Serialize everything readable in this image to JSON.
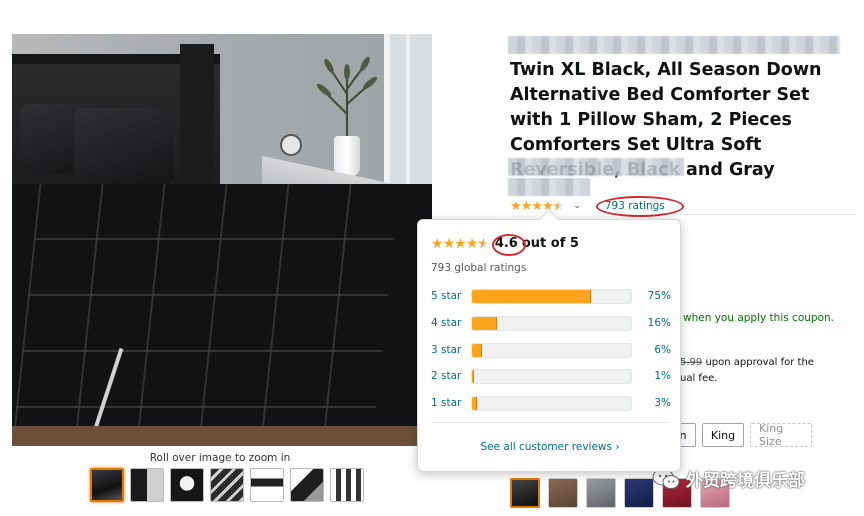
{
  "image_viewer": {
    "zoom_hint": "Roll over image to zoom in",
    "thumbnails": [
      {
        "name": "thumb-1",
        "active": true
      },
      {
        "name": "thumb-2",
        "active": false
      },
      {
        "name": "thumb-3",
        "active": false
      },
      {
        "name": "thumb-4",
        "active": false
      },
      {
        "name": "thumb-5",
        "active": false
      },
      {
        "name": "thumb-6",
        "active": false
      },
      {
        "name": "thumb-7",
        "active": false
      }
    ]
  },
  "product": {
    "title": "Twin XL Black, All Season Down Alternative Bed Comforter Set with 1 Pillow Sham, 2 Pieces Comforters Set Ultra Soft Reversible, Black and Gray",
    "rating_stars": 4.6,
    "ratings_link": "793 ratings"
  },
  "page_background": {
    "coupon_text": "when you apply this coupon.",
    "approval_price": "5.99",
    "approval_text": " upon approval for the",
    "approval_text_2": "ual fee.",
    "size_options": [
      {
        "label": "n",
        "available": true
      },
      {
        "label": "King",
        "available": true
      },
      {
        "label": "King Size",
        "available": false
      }
    ]
  },
  "rating_popover": {
    "average": "4.6",
    "out_of": "out of 5",
    "global_ratings": "793 global ratings",
    "histogram": [
      {
        "label": "5 star",
        "percent": 75,
        "percent_text": "75%"
      },
      {
        "label": "4 star",
        "percent": 16,
        "percent_text": "16%"
      },
      {
        "label": "3 star",
        "percent": 6,
        "percent_text": "6%"
      },
      {
        "label": "2 star",
        "percent": 1,
        "percent_text": "1%"
      },
      {
        "label": "1 star",
        "percent": 3,
        "percent_text": "3%"
      }
    ],
    "see_all": "See all customer reviews ›"
  },
  "watermark": {
    "text": "外贸跨境俱乐部",
    "icon": "wechat-icon"
  },
  "colors": {
    "star": "#ffa41c",
    "link": "#007185",
    "annotation_red": "#d7282f",
    "active_border": "#e77600"
  }
}
